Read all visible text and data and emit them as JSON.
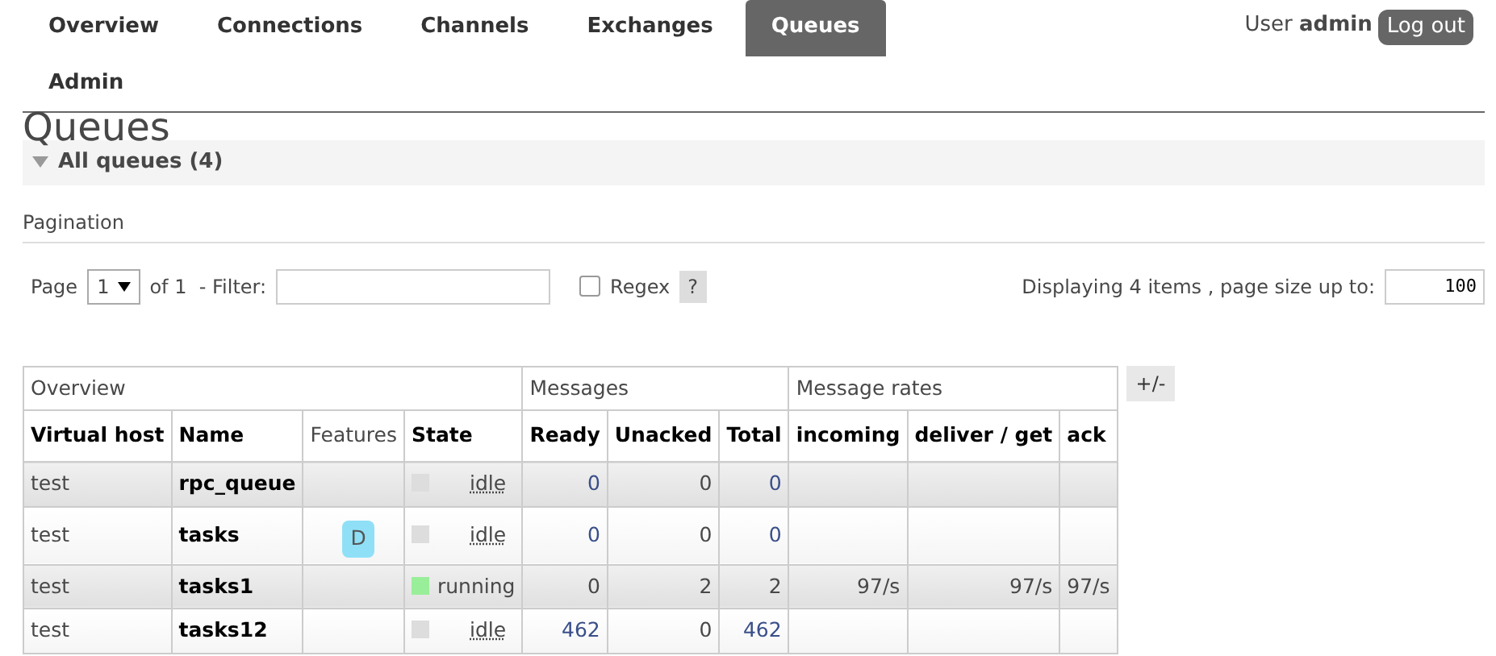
{
  "nav": {
    "tabs": [
      {
        "label": "Overview",
        "selected": false
      },
      {
        "label": "Connections",
        "selected": false
      },
      {
        "label": "Channels",
        "selected": false
      },
      {
        "label": "Exchanges",
        "selected": false
      },
      {
        "label": "Queues",
        "selected": true
      },
      {
        "label": "Admin",
        "selected": false
      }
    ],
    "user_label": "User",
    "user_name": "admin",
    "logout": "Log out"
  },
  "page_title": "Queues",
  "section": {
    "title": "All queues (4)",
    "expanded": true
  },
  "pagination": {
    "heading": "Pagination",
    "page_label": "Page",
    "page_value": "1",
    "of_label": "of 1  - Filter:",
    "regex_label": "Regex",
    "regex_checked": false,
    "help": "?",
    "displaying": "Displaying 4 items , page size up to:",
    "page_size": "100"
  },
  "table": {
    "groups": [
      {
        "label": "Overview",
        "columns": [
          {
            "label": "Virtual host",
            "bold": true
          },
          {
            "label": "Name",
            "bold": true
          },
          {
            "label": "Features",
            "bold": false
          },
          {
            "label": "State",
            "bold": true
          }
        ]
      },
      {
        "label": "Messages",
        "columns": [
          {
            "label": "Ready",
            "bold": true
          },
          {
            "label": "Unacked",
            "bold": true
          },
          {
            "label": "Total",
            "bold": true
          }
        ]
      },
      {
        "label": "Message rates",
        "columns": [
          {
            "label": "incoming",
            "bold": true
          },
          {
            "label": "deliver / get",
            "bold": true
          },
          {
            "label": "ack",
            "bold": true
          }
        ]
      }
    ],
    "rows": [
      {
        "vhost": "test",
        "name": "rpc_queue",
        "features": [],
        "state": "idle",
        "ready": {
          "text": "0",
          "link": true
        },
        "unacked": {
          "text": "0",
          "link": false
        },
        "total": {
          "text": "0",
          "link": true
        },
        "rates": []
      },
      {
        "vhost": "test",
        "name": "tasks",
        "features": [
          "D"
        ],
        "state": "idle",
        "ready": {
          "text": "0",
          "link": true
        },
        "unacked": {
          "text": "0",
          "link": false
        },
        "total": {
          "text": "0",
          "link": true
        },
        "rates": []
      },
      {
        "vhost": "test",
        "name": "tasks1",
        "features": [],
        "state": "running",
        "ready": {
          "text": "0",
          "link": false
        },
        "unacked": {
          "text": "2",
          "link": false
        },
        "total": {
          "text": "2",
          "link": false
        },
        "rates": [
          "97/s",
          "97/s",
          "97/s"
        ]
      },
      {
        "vhost": "test",
        "name": "tasks12",
        "features": [],
        "state": "idle",
        "ready": {
          "text": "462",
          "link": true
        },
        "unacked": {
          "text": "0",
          "link": false
        },
        "total": {
          "text": "462",
          "link": true
        },
        "rates": []
      }
    ],
    "toggle": "+/-"
  }
}
